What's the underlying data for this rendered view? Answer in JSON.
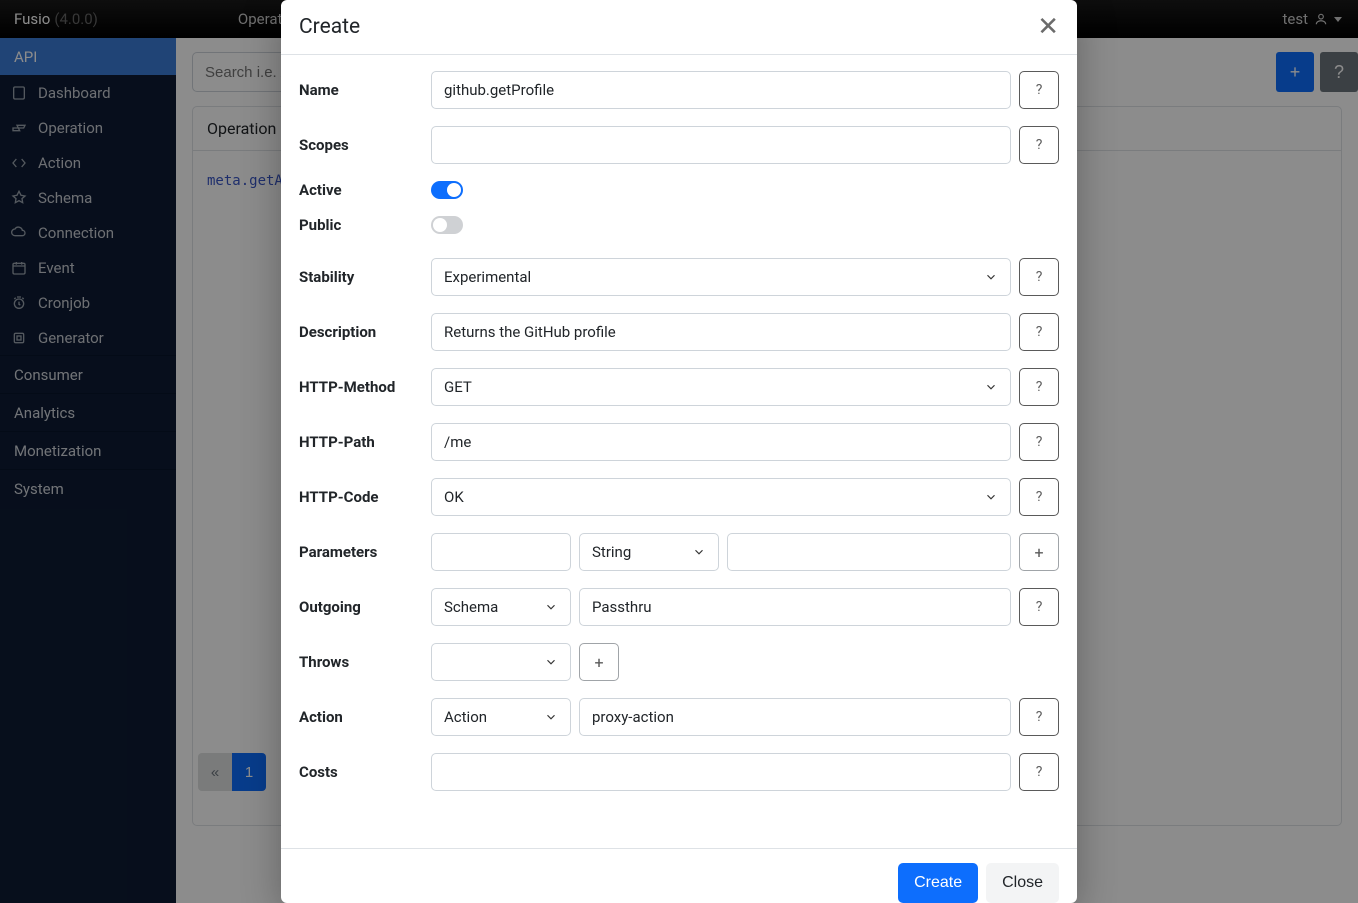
{
  "header": {
    "brand": "Fusio",
    "version": "(4.0.0)",
    "breadcrumb": "Operation",
    "user": "test"
  },
  "sidebar": {
    "groups": [
      {
        "label": "API",
        "active": true,
        "items": [
          {
            "icon": "dashboard-icon",
            "label": "Dashboard"
          },
          {
            "icon": "operation-icon",
            "label": "Operation"
          },
          {
            "icon": "action-icon",
            "label": "Action"
          },
          {
            "icon": "schema-icon",
            "label": "Schema"
          },
          {
            "icon": "connection-icon",
            "label": "Connection"
          },
          {
            "icon": "event-icon",
            "label": "Event"
          },
          {
            "icon": "cronjob-icon",
            "label": "Cronjob"
          },
          {
            "icon": "generator-icon",
            "label": "Generator"
          }
        ]
      },
      {
        "label": "Consumer",
        "active": false
      },
      {
        "label": "Analytics",
        "active": false
      },
      {
        "label": "Monetization",
        "active": false
      },
      {
        "label": "System",
        "active": false
      }
    ]
  },
  "content": {
    "search_placeholder": "Search i.e. /",
    "add_label": "+",
    "help_label": "?",
    "panel_title": "Operation",
    "rows": [
      "meta.getAb"
    ],
    "page_prev": "«",
    "page_current": "1"
  },
  "modal": {
    "title": "Create",
    "close_glyph": "✕",
    "help_glyph": "?",
    "plus_glyph": "+",
    "fields": {
      "name_label": "Name",
      "name_value": "github.getProfile",
      "scopes_label": "Scopes",
      "scopes_value": "",
      "active_label": "Active",
      "active_on": true,
      "public_label": "Public",
      "public_on": false,
      "stability_label": "Stability",
      "stability_value": "Experimental",
      "description_label": "Description",
      "description_value": "Returns the GitHub profile",
      "http_method_label": "HTTP-Method",
      "http_method_value": "GET",
      "http_path_label": "HTTP-Path",
      "http_path_value": "/me",
      "http_code_label": "HTTP-Code",
      "http_code_value": "OK",
      "parameters_label": "Parameters",
      "parameters_type_value": "String",
      "outgoing_label": "Outgoing",
      "outgoing_kind_value": "Schema",
      "outgoing_value": "Passthru",
      "throws_label": "Throws",
      "action_label": "Action",
      "action_kind_value": "Action",
      "action_value": "proxy-action",
      "costs_label": "Costs",
      "costs_value": ""
    },
    "footer": {
      "create": "Create",
      "close": "Close"
    }
  }
}
